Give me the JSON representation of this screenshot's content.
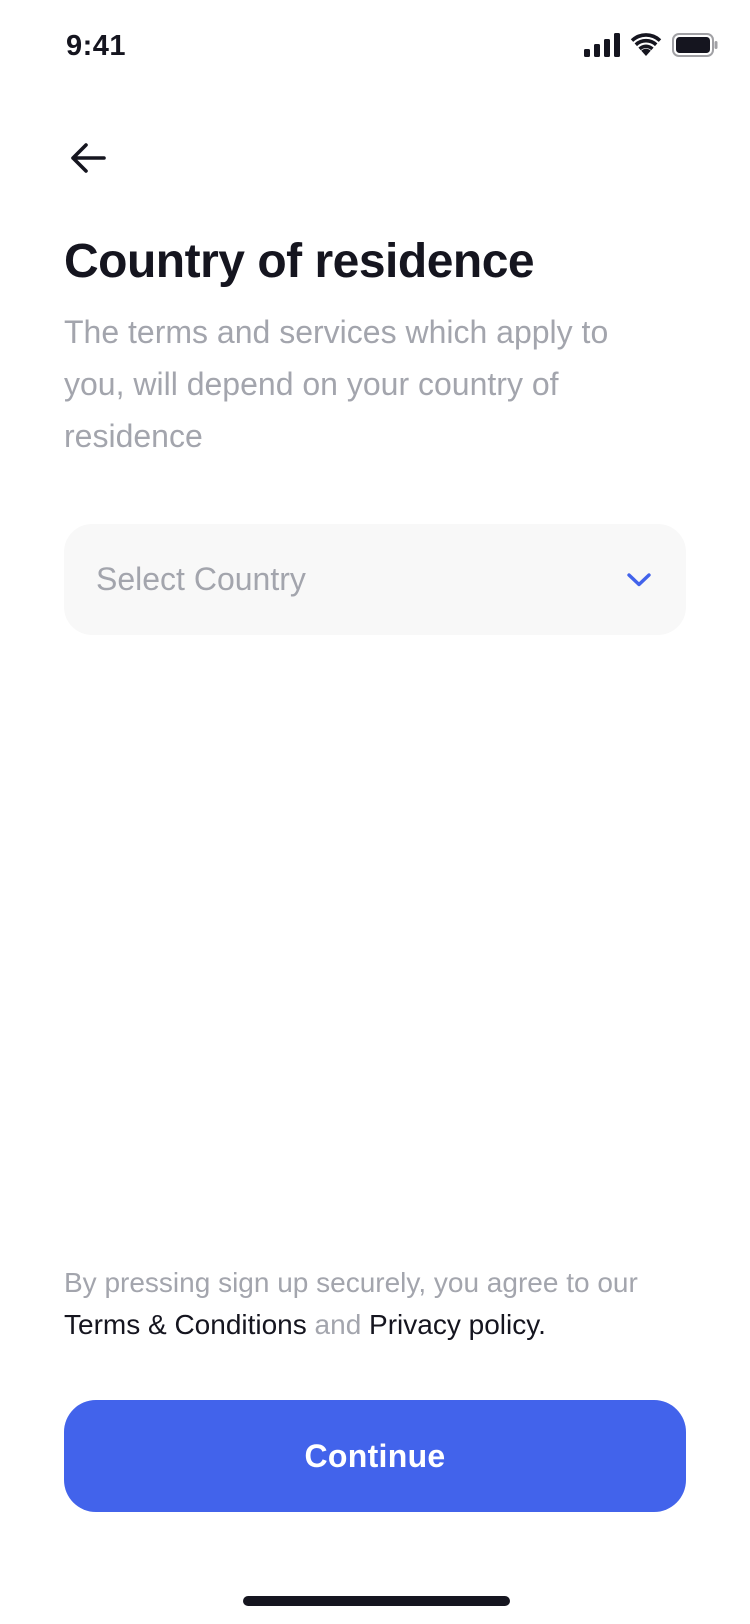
{
  "status_bar": {
    "time": "9:41",
    "icons": [
      "cellular-signal-icon",
      "wifi-icon",
      "battery-icon"
    ]
  },
  "header": {
    "back_icon": "arrow-left-icon"
  },
  "main": {
    "title": "Country of residence",
    "subtitle": "The terms and services which apply to you, will depend on your country of residence",
    "country_select": {
      "placeholder": "Select Country",
      "icon": "chevron-down-icon"
    }
  },
  "legal": {
    "prefix": "By pressing sign up securely, you agree to our",
    "terms_link": "Terms & Conditions",
    "conjunction": "and",
    "privacy_link": "Privacy policy",
    "suffix": "."
  },
  "actions": {
    "continue_label": "Continue"
  },
  "colors": {
    "accent": "#4263eb",
    "text_primary": "#15151f",
    "text_secondary": "#a3a5ad",
    "field_background": "#f8f8f8"
  }
}
